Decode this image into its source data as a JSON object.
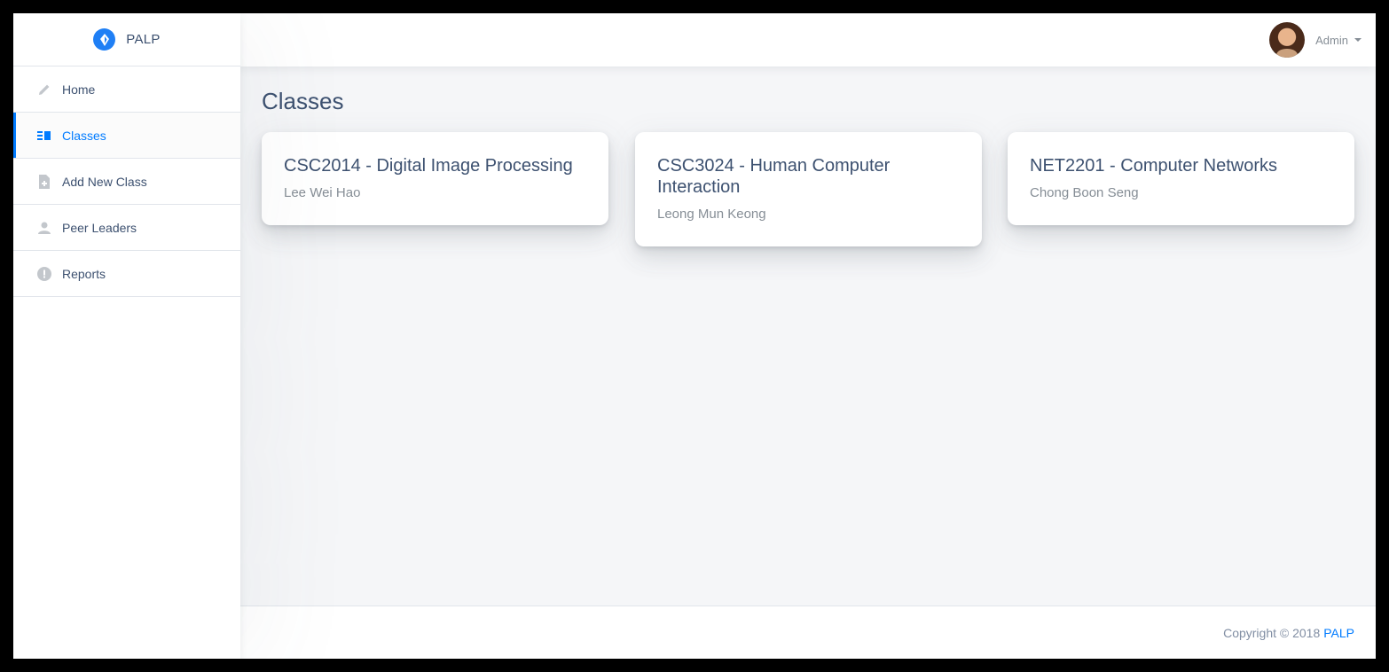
{
  "brand": {
    "name": "PALP",
    "logo_icon": "palp-logo-icon",
    "accent": "#007bff"
  },
  "sidebar": {
    "items": [
      {
        "label": "Home",
        "icon": "pencil-icon",
        "active": false
      },
      {
        "label": "Classes",
        "icon": "list-icon",
        "active": true
      },
      {
        "label": "Add New Class",
        "icon": "note-add-icon",
        "active": false
      },
      {
        "label": "Peer Leaders",
        "icon": "person-icon",
        "active": false
      },
      {
        "label": "Reports",
        "icon": "error-icon",
        "active": false
      }
    ]
  },
  "user": {
    "name": "Admin",
    "avatar": "avatar"
  },
  "page": {
    "title": "Classes"
  },
  "classes": [
    {
      "title": "CSC2014 - Digital Image Processing",
      "lecturer": "Lee Wei Hao"
    },
    {
      "title": "CSC3024 - Human Computer Interaction",
      "lecturer": "Leong Mun Keong"
    },
    {
      "title": "NET2201 - Computer Networks",
      "lecturer": "Chong Boon Seng"
    }
  ],
  "footer": {
    "copyright": "Copyright © 2018",
    "link": "PALP"
  }
}
